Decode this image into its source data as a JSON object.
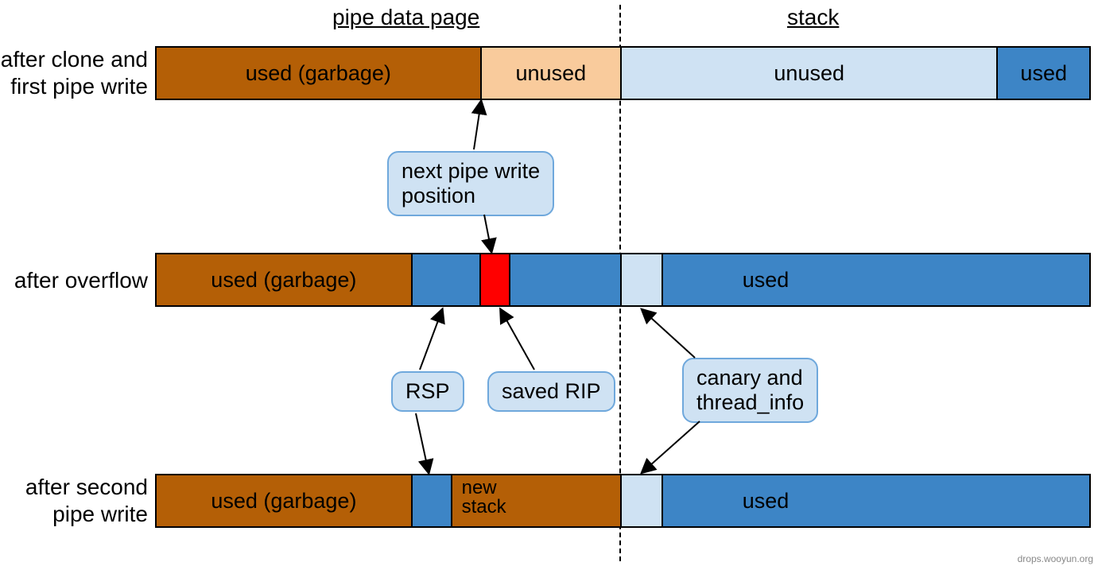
{
  "headers": {
    "pipe": "pipe data page",
    "stack": "stack"
  },
  "row_labels": {
    "r1a": "after clone and",
    "r1b": "first pipe write",
    "r2": "after overflow",
    "r3a": "after second",
    "r3b": "pipe write"
  },
  "segments": {
    "row1": {
      "a": "used (garbage)",
      "b": "unused",
      "c": "unused",
      "d": "used"
    },
    "row2": {
      "a": "used (garbage)",
      "d": "used"
    },
    "row3": {
      "a": "used (garbage)",
      "c": "new\nstack",
      "e": "used"
    }
  },
  "balloons": {
    "pipe_write": "next pipe write\nposition",
    "rsp": "RSP",
    "rip": "saved RIP",
    "canary": "canary and\nthread_info"
  },
  "watermark": "drops.wooyun.org",
  "colors": {
    "brown": "#b45f06",
    "tan": "#f9cb9c",
    "lblue": "#cfe2f3",
    "blue": "#3d85c6",
    "red": "#ff0000"
  }
}
